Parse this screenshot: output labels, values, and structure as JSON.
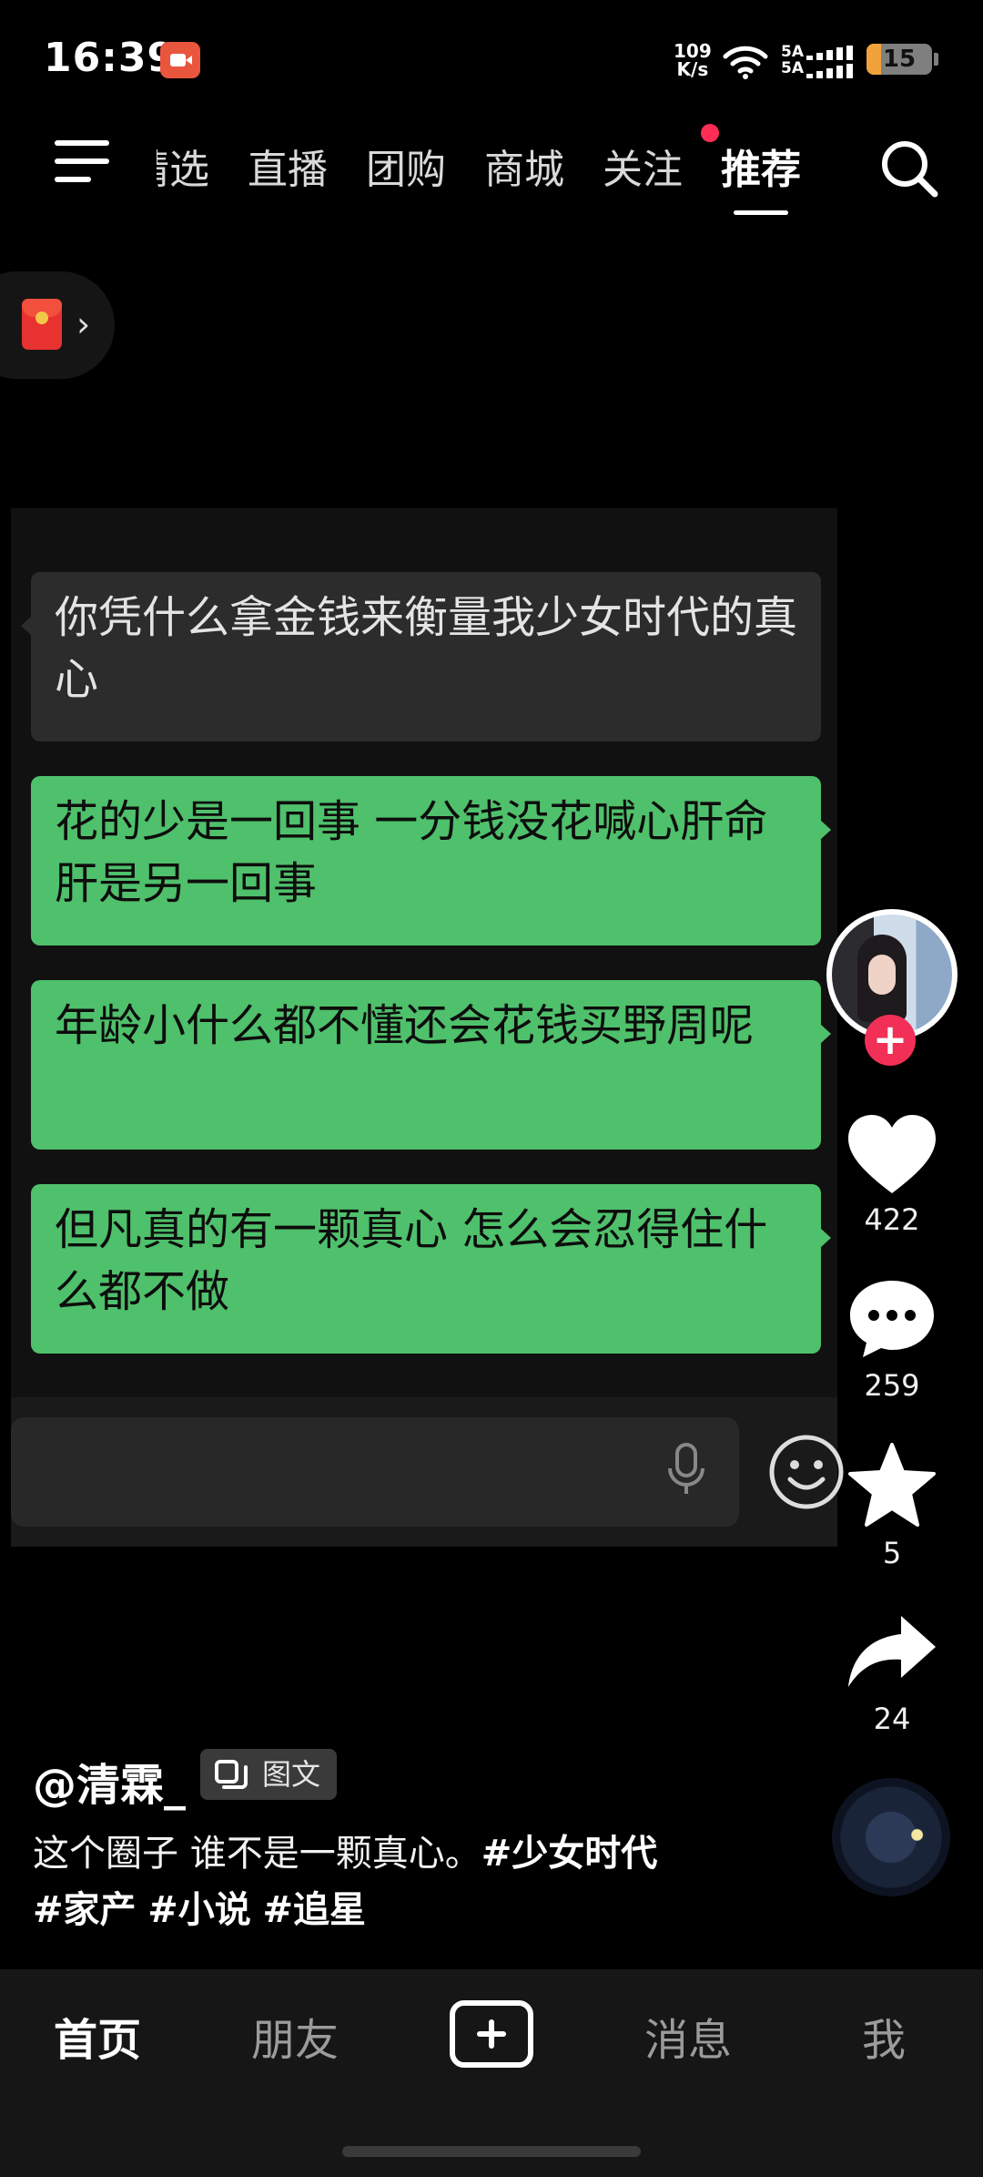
{
  "status_bar": {
    "time": "16:39",
    "net_speed_value": "109",
    "net_speed_unit": "K/s",
    "signal_label_1": "5A",
    "signal_label_2": "5A",
    "battery": "15"
  },
  "top_nav": {
    "tabs": [
      {
        "label": "精选"
      },
      {
        "label": "直播"
      },
      {
        "label": "团购"
      },
      {
        "label": "商城"
      },
      {
        "label": "关注"
      },
      {
        "label": "推荐"
      }
    ],
    "active_tab": "推荐",
    "notice_dot_color": "#ff2c55"
  },
  "chat": {
    "messages": [
      {
        "side": "in",
        "text": "你凭什么拿金钱来衡量我少女时代的真心"
      },
      {
        "side": "out",
        "text": "花的少是一回事 一分钱没花喊心肝命肝是另一回事"
      },
      {
        "side": "out",
        "text": "年龄小什么都不懂还会花钱买野周呢"
      },
      {
        "side": "out",
        "text": "但凡真的有一颗真心 怎么会忍得住什么都不做"
      }
    ],
    "bubble_out_color": "#4fc06b",
    "bubble_in_color": "#2c2c2c"
  },
  "rail": {
    "likes": "422",
    "comments": "259",
    "favorites": "5",
    "shares": "24"
  },
  "post": {
    "author": "@清霖_",
    "type_tag": "图文",
    "caption_text": "这个圈子 谁不是一颗真心。",
    "hashtags": [
      "#少女时代",
      "#家产",
      "#小说",
      "#追星"
    ]
  },
  "bottom_nav": {
    "home": "首页",
    "friends": "朋友",
    "messages": "消息",
    "me": "我"
  }
}
